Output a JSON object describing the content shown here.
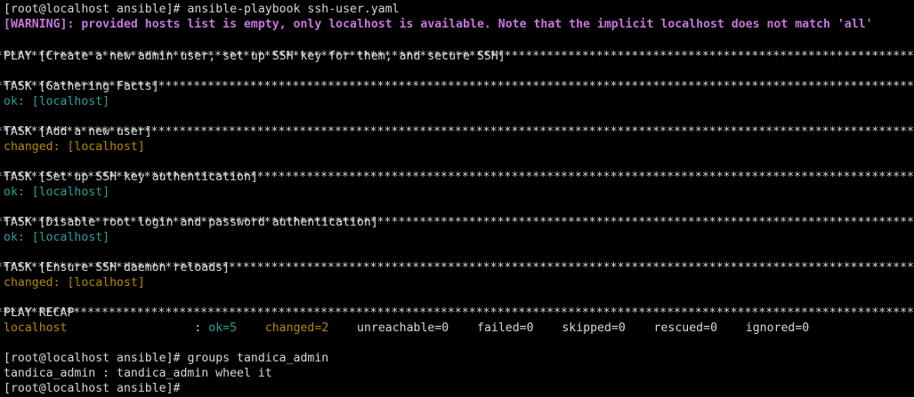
{
  "colors": {
    "background": "#000000",
    "text": "#d8d8d8",
    "warning": "#c678dd",
    "ok": "#2aa198",
    "changed": "#b58900"
  },
  "lines": {
    "cmd1_prompt": "[root@localhost ansible]# ",
    "cmd1_command": "ansible-playbook ssh-user.yaml",
    "warning": "[WARNING]: provided hosts list is empty, only localhost is available. Note that the implicit localhost does not match 'all'",
    "play_header": "PLAY [Create a new admin user, set up SSH key for them, and secure SSH] ",
    "task1_header": "TASK [Gathering Facts] ",
    "task1_result": "ok: [localhost]",
    "task2_header": "TASK [Add a new user] ",
    "task2_result": "changed: [localhost]",
    "task3_header": "TASK [Set up SSH key authentication] ",
    "task3_result": "ok: [localhost]",
    "task4_header": "TASK [Disable root login and password authentication] ",
    "task4_result": "ok: [localhost]",
    "task5_header": "TASK [Ensure SSH daemon reloads] ",
    "task5_result": "changed: [localhost]",
    "recap_header": "PLAY RECAP ",
    "cmd2_prompt": "[root@localhost ansible]# ",
    "cmd2_command": "groups tandica_admin",
    "cmd2_output": "tandica_admin : tandica_admin wheel it",
    "cmd3_prompt": "[root@localhost ansible]# "
  },
  "recap": {
    "host": "localhost                  ",
    "sep": ": ",
    "ok": "ok=5",
    "changed": "changed=2",
    "unreachable": "unreachable=0",
    "failed": "failed=0",
    "skipped": "skipped=0",
    "rescued": "rescued=0",
    "ignored": "ignored=0"
  }
}
